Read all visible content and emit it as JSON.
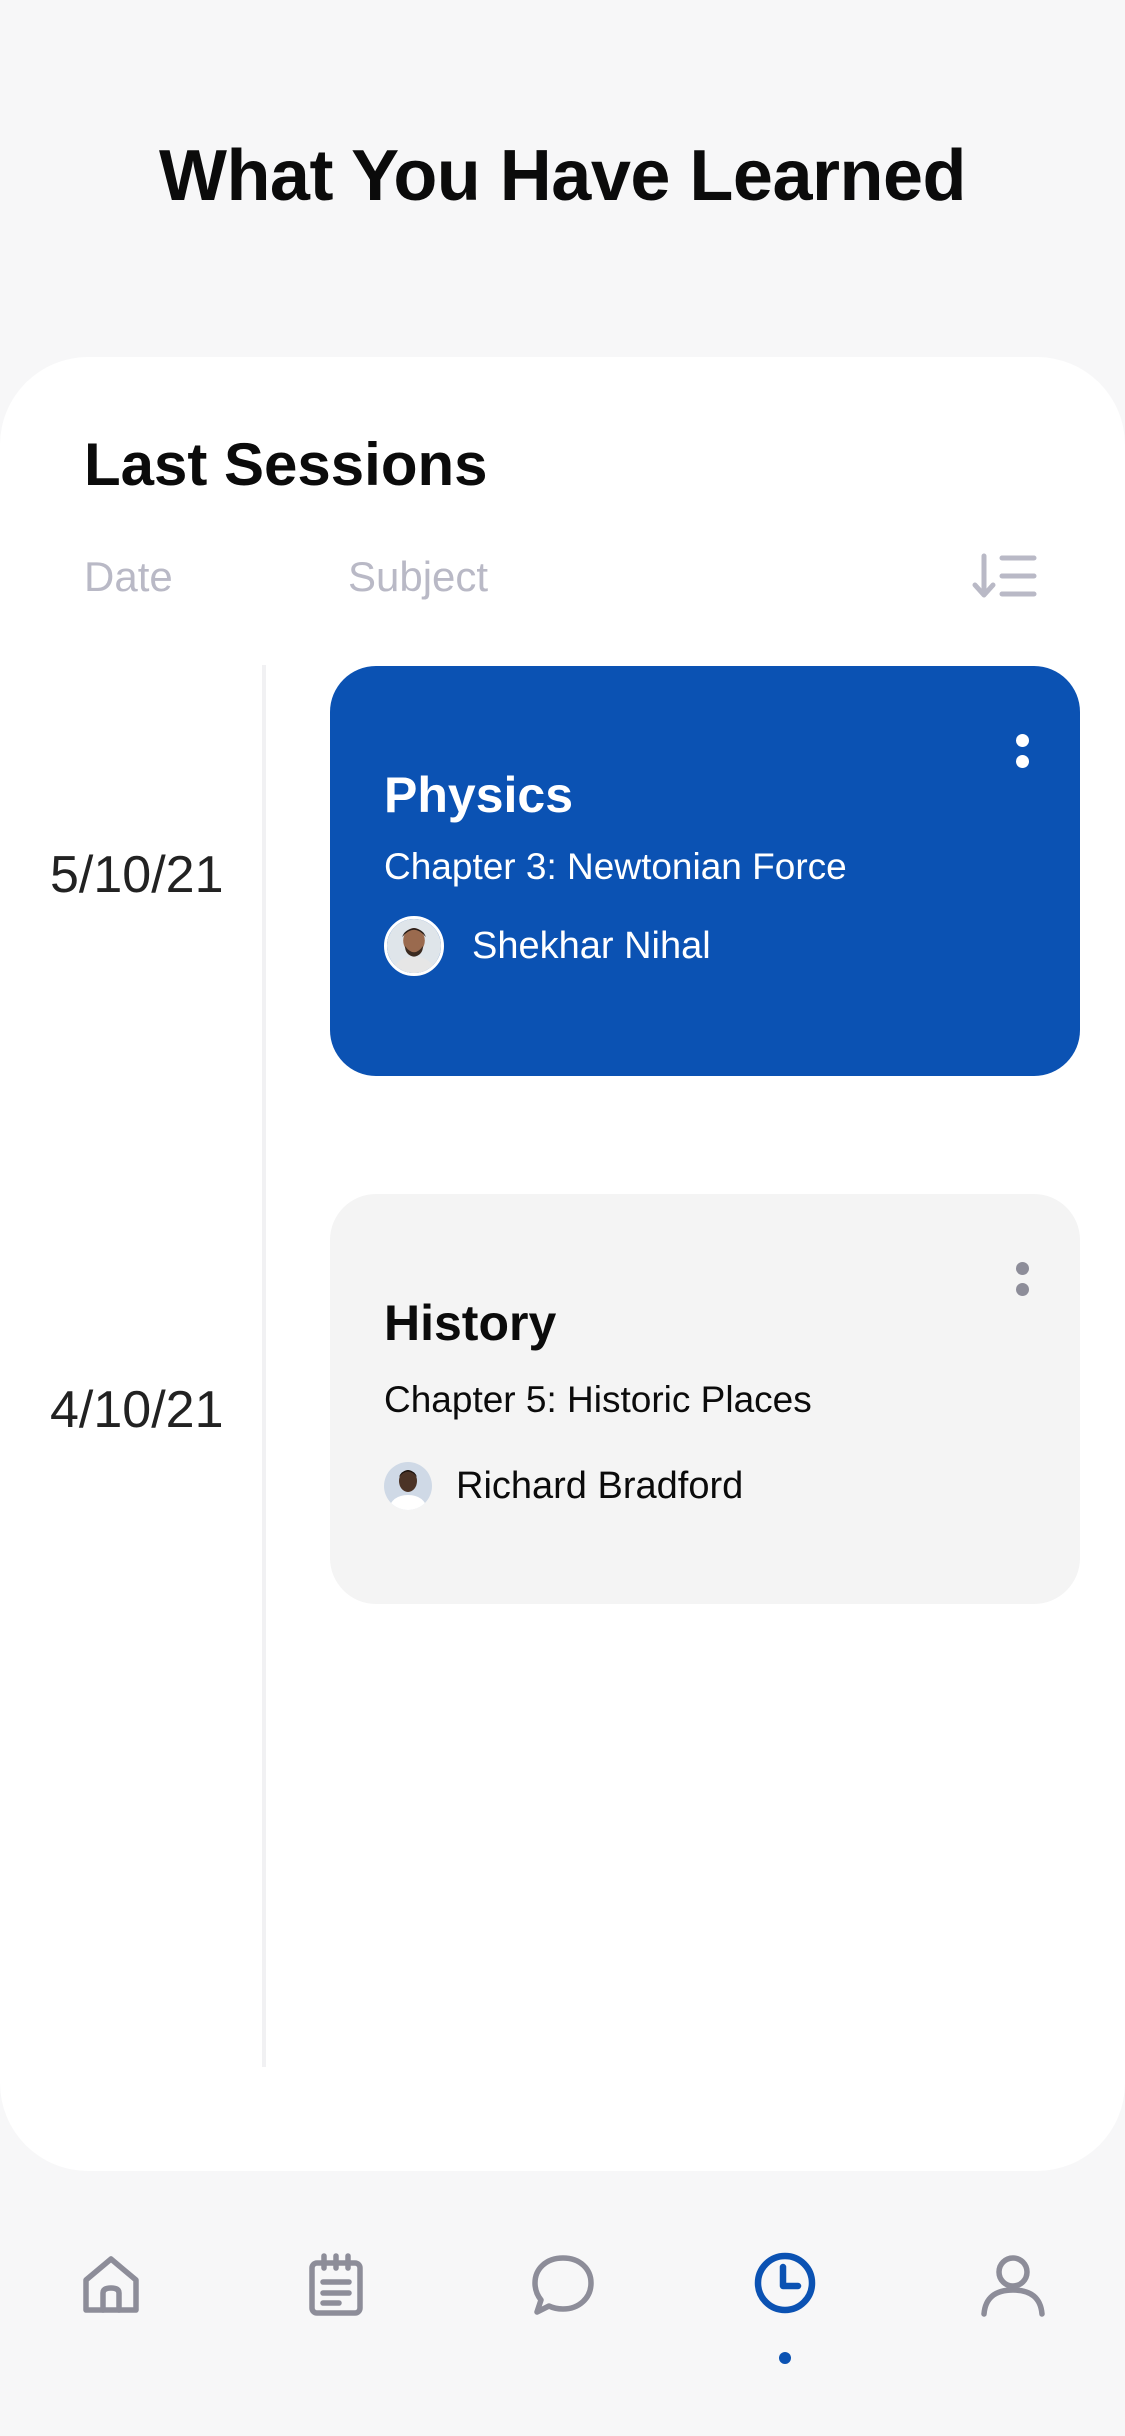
{
  "header": {
    "title": "What You Have Learned"
  },
  "sessions_panel": {
    "title": "Last Sessions",
    "columns": {
      "date": "Date",
      "subject": "Subject"
    },
    "sort_icon": "sort-descending-icon"
  },
  "sessions": [
    {
      "date": "5/10/21",
      "subject": "Physics",
      "chapter": "Chapter 3: Newtonian Force",
      "teacher": "Shekhar Nihal",
      "highlighted": true,
      "card_color": "#0b52b3"
    },
    {
      "date": "4/10/21",
      "subject": "History",
      "chapter": "Chapter 5: Historic Places",
      "teacher": "Richard Bradford",
      "highlighted": false,
      "card_color": "#f4f4f4"
    }
  ],
  "tabbar": {
    "items": [
      {
        "name": "home",
        "icon": "home-icon",
        "active": false
      },
      {
        "name": "notes",
        "icon": "clipboard-icon",
        "active": false
      },
      {
        "name": "chat",
        "icon": "chat-bubble-icon",
        "active": false
      },
      {
        "name": "history",
        "icon": "clock-icon",
        "active": true
      },
      {
        "name": "profile",
        "icon": "user-icon",
        "active": false
      }
    ],
    "active_color": "#0b52b3",
    "inactive_color": "#8d8d99"
  }
}
